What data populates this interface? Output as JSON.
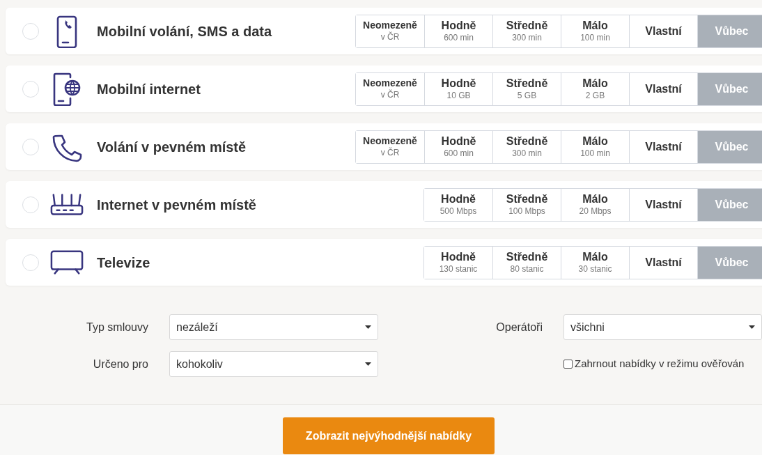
{
  "services": [
    {
      "name": "Mobilní volání, SMS a data",
      "kind": "mobile-call",
      "checked": false,
      "options": [
        {
          "label": "Neomezeně",
          "detail": "v ČR",
          "selected": false
        },
        {
          "label": "Hodně",
          "detail": "600 min",
          "selected": false
        },
        {
          "label": "Středně",
          "detail": "300 min",
          "selected": false
        },
        {
          "label": "Málo",
          "detail": "100 min",
          "selected": false
        },
        {
          "label": "Vlastní",
          "selected": false
        },
        {
          "label": "Vůbec",
          "selected": true
        }
      ]
    },
    {
      "name": "Mobilní internet",
      "kind": "mobile-globe",
      "checked": false,
      "options": [
        {
          "label": "Neomezeně",
          "detail": "v ČR",
          "selected": false
        },
        {
          "label": "Hodně",
          "detail": "10 GB",
          "selected": false
        },
        {
          "label": "Středně",
          "detail": "5 GB",
          "selected": false
        },
        {
          "label": "Málo",
          "detail": "2 GB",
          "selected": false
        },
        {
          "label": "Vlastní",
          "selected": false
        },
        {
          "label": "Vůbec",
          "selected": true
        }
      ]
    },
    {
      "name": "Volání v pevném místě",
      "kind": "handset",
      "checked": false,
      "options": [
        {
          "label": "Neomezeně",
          "detail": "v ČR",
          "selected": false
        },
        {
          "label": "Hodně",
          "detail": "600 min",
          "selected": false
        },
        {
          "label": "Středně",
          "detail": "300 min",
          "selected": false
        },
        {
          "label": "Málo",
          "detail": "100 min",
          "selected": false
        },
        {
          "label": "Vlastní",
          "selected": false
        },
        {
          "label": "Vůbec",
          "selected": true
        }
      ]
    },
    {
      "name": "Internet v pevném místě",
      "kind": "router",
      "checked": false,
      "options": [
        {
          "label": "Hodně",
          "detail": "500 Mbps",
          "selected": false
        },
        {
          "label": "Středně",
          "detail": "100 Mbps",
          "selected": false
        },
        {
          "label": "Málo",
          "detail": "20 Mbps",
          "selected": false
        },
        {
          "label": "Vlastní",
          "selected": false
        },
        {
          "label": "Vůbec",
          "selected": true
        }
      ]
    },
    {
      "name": "Televize",
      "kind": "tv",
      "checked": false,
      "options": [
        {
          "label": "Hodně",
          "detail": "130 stanic",
          "selected": false
        },
        {
          "label": "Středně",
          "detail": "80 stanic",
          "selected": false
        },
        {
          "label": "Málo",
          "detail": "30 stanic",
          "selected": false
        },
        {
          "label": "Vlastní",
          "selected": false
        },
        {
          "label": "Vůbec",
          "selected": true
        }
      ]
    }
  ],
  "filters": {
    "contract_type": {
      "label": "Typ smlouvy",
      "value": "nezáleží"
    },
    "intended_for": {
      "label": "Určeno pro",
      "value": "kohokoliv"
    },
    "operators": {
      "label": "Operátoři",
      "value": "všichni"
    },
    "include_verifying": {
      "label": "Zahrnout nabídky v režimu ověřován",
      "checked": false
    }
  },
  "submit": "Zobrazit nejvýhodnější nabídky"
}
